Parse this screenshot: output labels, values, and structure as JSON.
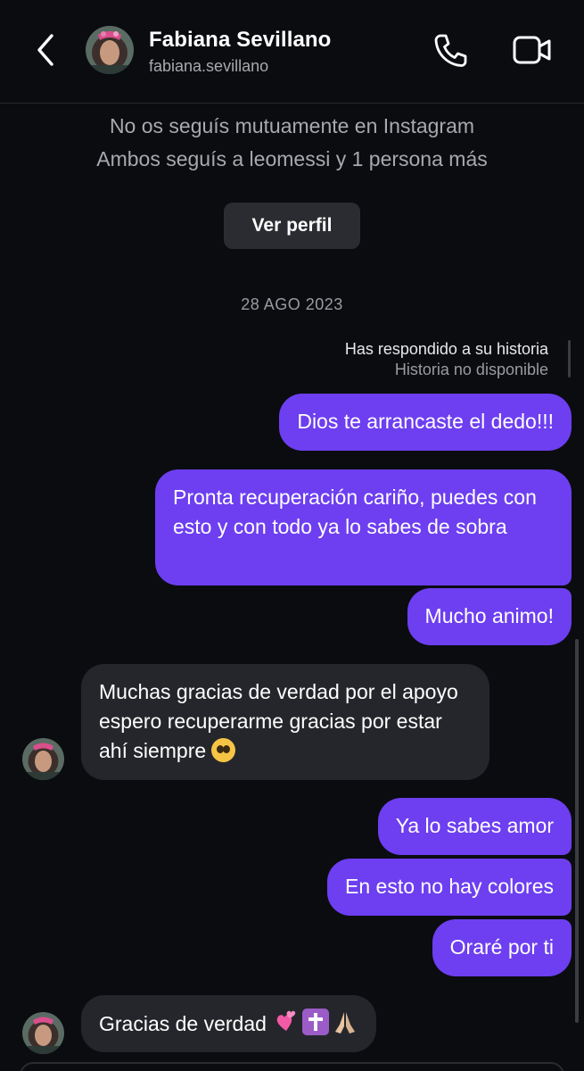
{
  "header": {
    "name": "Fabiana Sevillano",
    "username": "fabiana.sevillano"
  },
  "profile": {
    "line1": "No os seguís mutuamente en Instagram",
    "line2": "Ambos seguís a leomessi y 1 persona más",
    "button_label": "Ver perfil"
  },
  "conversation": {
    "date": "28 AGO 2023",
    "reply_note": "Has respondido a su historia",
    "reply_sub": "Historia no disponible",
    "messages": [
      {
        "from": "me",
        "text": "Dios te arrancaste el dedo!!!"
      },
      {
        "from": "me",
        "text": "Pronta recuperación cariño, puedes con esto y con todo ya lo sabes de sobra"
      },
      {
        "from": "me",
        "text": "Mucho animo!"
      },
      {
        "from": "them",
        "text": "Muchas gracias de verdad por el apoyo espero recuperarme gracias por estar ahí siempre",
        "emoji": "pleading-face"
      },
      {
        "from": "me",
        "text": "Ya lo sabes amor"
      },
      {
        "from": "me",
        "text": "En esto no hay colores"
      },
      {
        "from": "me",
        "text": "Oraré por ti"
      },
      {
        "from": "them",
        "text": "Gracias de verdad",
        "emoji": "two-hearts, latin-cross, folded-hands"
      }
    ]
  },
  "colors": {
    "background": "#0b0c10",
    "outgoing_bubble": "#6d3ff0",
    "incoming_bubble": "#25262b"
  }
}
